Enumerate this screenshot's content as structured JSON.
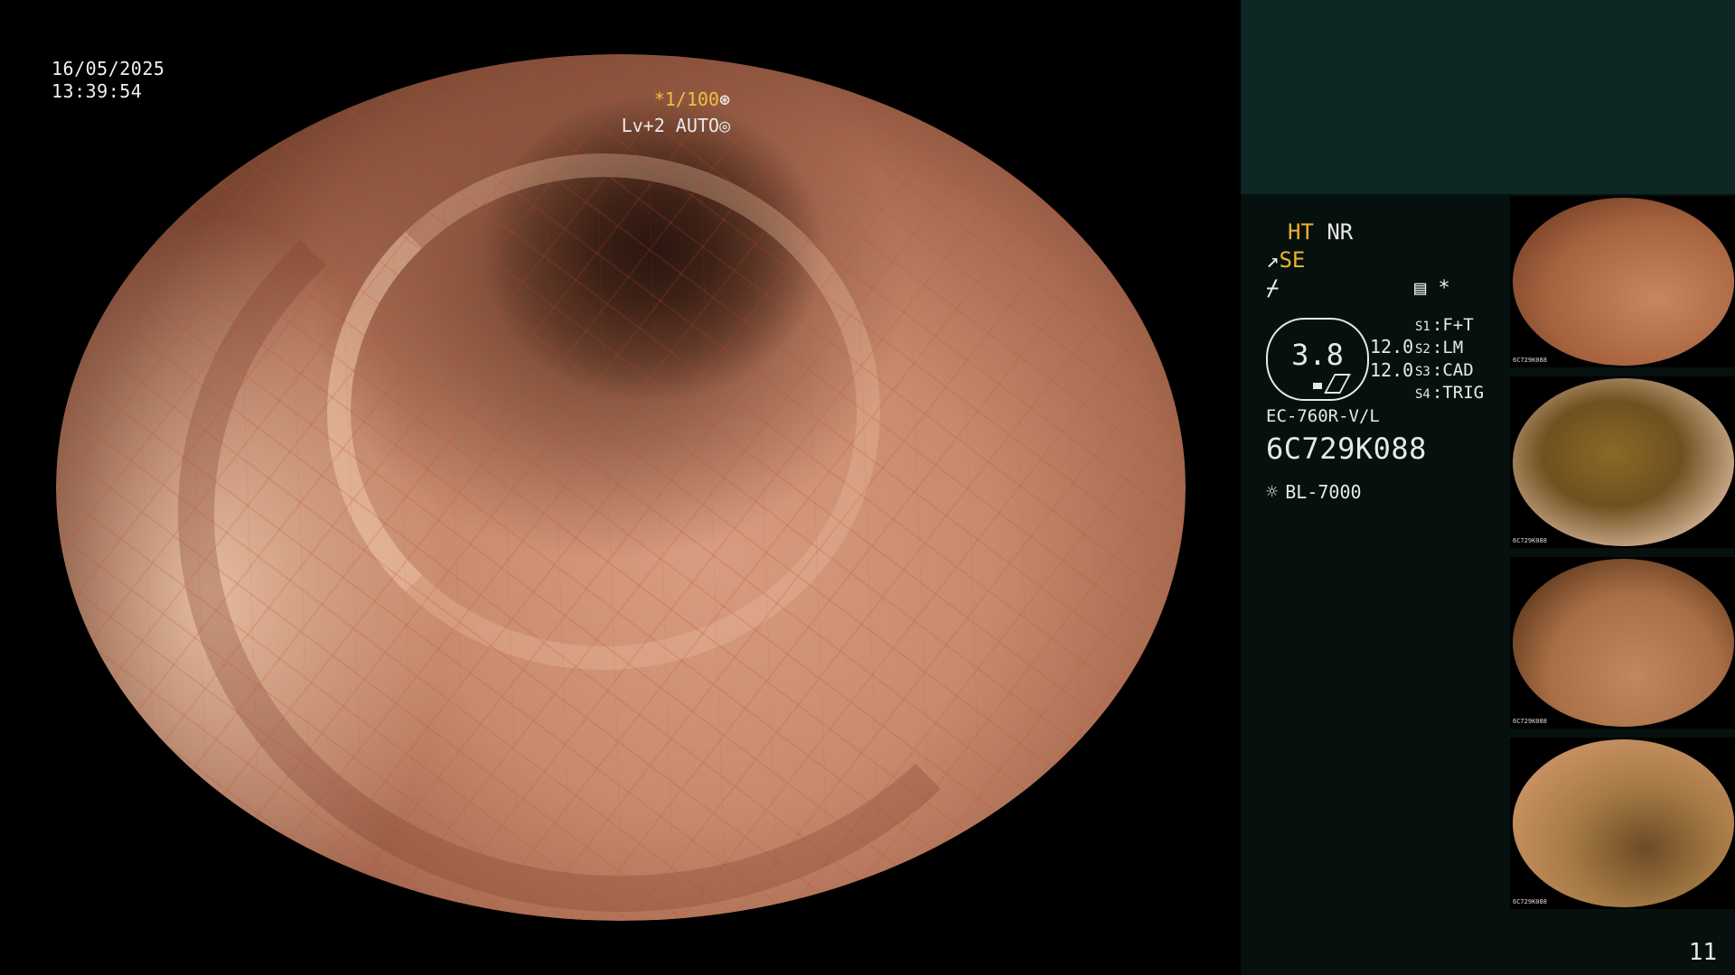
{
  "datetime": {
    "date": "16/05/2025",
    "time": "13:39:54"
  },
  "overlay": {
    "shutter_prefix": "*1/100",
    "shutter_icon": "⊛",
    "level": "Lv+2 AUTO",
    "level_icon": "◎"
  },
  "panel": {
    "ht_label": "HT",
    "nr_label": "NR",
    "se_icon": "↗",
    "se_label": "SE",
    "tilde_icon": "⌿",
    "menu_icon": "▤",
    "star_icon": "*",
    "bag_value": "3.8",
    "pressure1": "12.0",
    "pressure2": "12.0",
    "switches": [
      {
        "key": "S1",
        "value": "F+T"
      },
      {
        "key": "S2",
        "value": "LM"
      },
      {
        "key": "S3",
        "value": "CAD"
      },
      {
        "key": "S4",
        "value": "TRIG"
      }
    ],
    "scope_model": "EC-760R-V/L",
    "serial": "6C729K088",
    "light_icon": "☼",
    "light_source": "BL-7000",
    "page_number": "11"
  },
  "thumbnails": [
    {
      "serial": "6C729K088"
    },
    {
      "serial": "6C729K088"
    },
    {
      "serial": "6C729K088"
    },
    {
      "serial": "6C729K088"
    }
  ]
}
